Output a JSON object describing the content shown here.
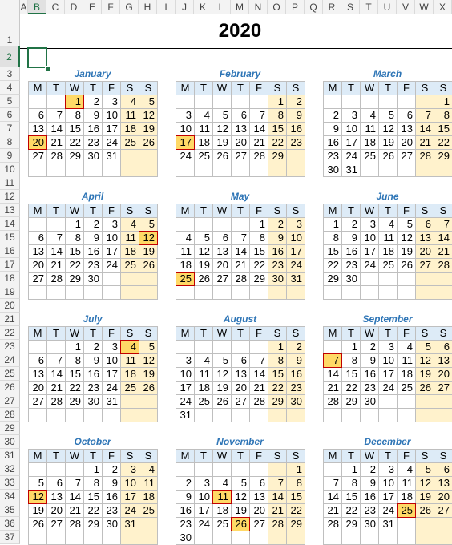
{
  "sheet": {
    "columns": [
      "A",
      "B",
      "C",
      "D",
      "E",
      "F",
      "G",
      "H",
      "I",
      "J",
      "K",
      "L",
      "M",
      "N",
      "O",
      "P",
      "Q",
      "R",
      "S",
      "T",
      "U",
      "V",
      "W",
      "X"
    ],
    "selected_cell": "B2",
    "title": "2020"
  },
  "weekday_headers": [
    "M",
    "T",
    "W",
    "T",
    "F",
    "S",
    "S"
  ],
  "colors": {
    "header": "#ddebf7",
    "weekend": "#fff2cc",
    "holiday": "#ffd966",
    "holiday_border": "#c00000",
    "month_title": "#2e75b6"
  },
  "months": [
    {
      "name": "January",
      "holidays": [
        1,
        20
      ],
      "weeks": [
        [
          null,
          null,
          1,
          2,
          3,
          4,
          5
        ],
        [
          6,
          7,
          8,
          9,
          10,
          11,
          12
        ],
        [
          13,
          14,
          15,
          16,
          17,
          18,
          19
        ],
        [
          20,
          21,
          22,
          23,
          24,
          25,
          26
        ],
        [
          27,
          28,
          29,
          30,
          31,
          null,
          null
        ],
        [
          null,
          null,
          null,
          null,
          null,
          null,
          null
        ]
      ]
    },
    {
      "name": "February",
      "holidays": [
        17
      ],
      "weeks": [
        [
          null,
          null,
          null,
          null,
          null,
          1,
          2
        ],
        [
          3,
          4,
          5,
          6,
          7,
          8,
          9
        ],
        [
          10,
          11,
          12,
          13,
          14,
          15,
          16
        ],
        [
          17,
          18,
          19,
          20,
          21,
          22,
          23
        ],
        [
          24,
          25,
          26,
          27,
          28,
          29,
          null
        ],
        [
          null,
          null,
          null,
          null,
          null,
          null,
          null
        ]
      ]
    },
    {
      "name": "March",
      "holidays": [],
      "weeks": [
        [
          null,
          null,
          null,
          null,
          null,
          null,
          1
        ],
        [
          2,
          3,
          4,
          5,
          6,
          7,
          8
        ],
        [
          9,
          10,
          11,
          12,
          13,
          14,
          15
        ],
        [
          16,
          17,
          18,
          19,
          20,
          21,
          22
        ],
        [
          23,
          24,
          25,
          26,
          27,
          28,
          29
        ],
        [
          30,
          31,
          null,
          null,
          null,
          null,
          null
        ]
      ]
    },
    {
      "name": "April",
      "holidays": [
        12
      ],
      "weeks": [
        [
          null,
          null,
          1,
          2,
          3,
          4,
          5
        ],
        [
          6,
          7,
          8,
          9,
          10,
          11,
          12
        ],
        [
          13,
          14,
          15,
          16,
          17,
          18,
          19
        ],
        [
          20,
          21,
          22,
          23,
          24,
          25,
          26
        ],
        [
          27,
          28,
          29,
          30,
          null,
          null,
          null
        ],
        [
          null,
          null,
          null,
          null,
          null,
          null,
          null
        ]
      ]
    },
    {
      "name": "May",
      "holidays": [
        25
      ],
      "weeks": [
        [
          null,
          null,
          null,
          null,
          1,
          2,
          3
        ],
        [
          4,
          5,
          6,
          7,
          8,
          9,
          10
        ],
        [
          11,
          12,
          13,
          14,
          15,
          16,
          17
        ],
        [
          18,
          19,
          20,
          21,
          22,
          23,
          24
        ],
        [
          25,
          26,
          27,
          28,
          29,
          30,
          31
        ],
        [
          null,
          null,
          null,
          null,
          null,
          null,
          null
        ]
      ]
    },
    {
      "name": "June",
      "holidays": [],
      "weeks": [
        [
          1,
          2,
          3,
          4,
          5,
          6,
          7
        ],
        [
          8,
          9,
          10,
          11,
          12,
          13,
          14
        ],
        [
          15,
          16,
          17,
          18,
          19,
          20,
          21
        ],
        [
          22,
          23,
          24,
          25,
          26,
          27,
          28
        ],
        [
          29,
          30,
          null,
          null,
          null,
          null,
          null
        ],
        [
          null,
          null,
          null,
          null,
          null,
          null,
          null
        ]
      ]
    },
    {
      "name": "July",
      "holidays": [
        4
      ],
      "weeks": [
        [
          null,
          null,
          1,
          2,
          3,
          4,
          5
        ],
        [
          6,
          7,
          8,
          9,
          10,
          11,
          12
        ],
        [
          13,
          14,
          15,
          16,
          17,
          18,
          19
        ],
        [
          20,
          21,
          22,
          23,
          24,
          25,
          26
        ],
        [
          27,
          28,
          29,
          30,
          31,
          null,
          null
        ],
        [
          null,
          null,
          null,
          null,
          null,
          null,
          null
        ]
      ]
    },
    {
      "name": "August",
      "holidays": [],
      "weeks": [
        [
          null,
          null,
          null,
          null,
          null,
          1,
          2
        ],
        [
          3,
          4,
          5,
          6,
          7,
          8,
          9
        ],
        [
          10,
          11,
          12,
          13,
          14,
          15,
          16
        ],
        [
          17,
          18,
          19,
          20,
          21,
          22,
          23
        ],
        [
          24,
          25,
          26,
          27,
          28,
          29,
          30
        ],
        [
          31,
          null,
          null,
          null,
          null,
          null,
          null
        ]
      ]
    },
    {
      "name": "September",
      "holidays": [
        7
      ],
      "weeks": [
        [
          null,
          1,
          2,
          3,
          4,
          5,
          6
        ],
        [
          7,
          8,
          9,
          10,
          11,
          12,
          13
        ],
        [
          14,
          15,
          16,
          17,
          18,
          19,
          20
        ],
        [
          21,
          22,
          23,
          24,
          25,
          26,
          27
        ],
        [
          28,
          29,
          30,
          null,
          null,
          null,
          null
        ],
        [
          null,
          null,
          null,
          null,
          null,
          null,
          null
        ]
      ]
    },
    {
      "name": "October",
      "holidays": [
        12
      ],
      "weeks": [
        [
          null,
          null,
          null,
          1,
          2,
          3,
          4
        ],
        [
          5,
          6,
          7,
          8,
          9,
          10,
          11
        ],
        [
          12,
          13,
          14,
          15,
          16,
          17,
          18
        ],
        [
          19,
          20,
          21,
          22,
          23,
          24,
          25
        ],
        [
          26,
          27,
          28,
          29,
          30,
          31,
          null
        ],
        [
          null,
          null,
          null,
          null,
          null,
          null,
          null
        ]
      ]
    },
    {
      "name": "November",
      "holidays": [
        11,
        26
      ],
      "weeks": [
        [
          null,
          null,
          null,
          null,
          null,
          null,
          1
        ],
        [
          2,
          3,
          4,
          5,
          6,
          7,
          8
        ],
        [
          9,
          10,
          11,
          12,
          13,
          14,
          15
        ],
        [
          16,
          17,
          18,
          19,
          20,
          21,
          22
        ],
        [
          23,
          24,
          25,
          26,
          27,
          28,
          29
        ],
        [
          30,
          null,
          null,
          null,
          null,
          null,
          null
        ]
      ]
    },
    {
      "name": "December",
      "holidays": [
        25
      ],
      "weeks": [
        [
          null,
          1,
          2,
          3,
          4,
          5,
          6
        ],
        [
          7,
          8,
          9,
          10,
          11,
          12,
          13
        ],
        [
          14,
          15,
          16,
          17,
          18,
          19,
          20
        ],
        [
          21,
          22,
          23,
          24,
          25,
          26,
          27
        ],
        [
          28,
          29,
          30,
          31,
          null,
          null,
          null
        ],
        [
          null,
          null,
          null,
          null,
          null,
          null,
          null
        ]
      ]
    }
  ]
}
